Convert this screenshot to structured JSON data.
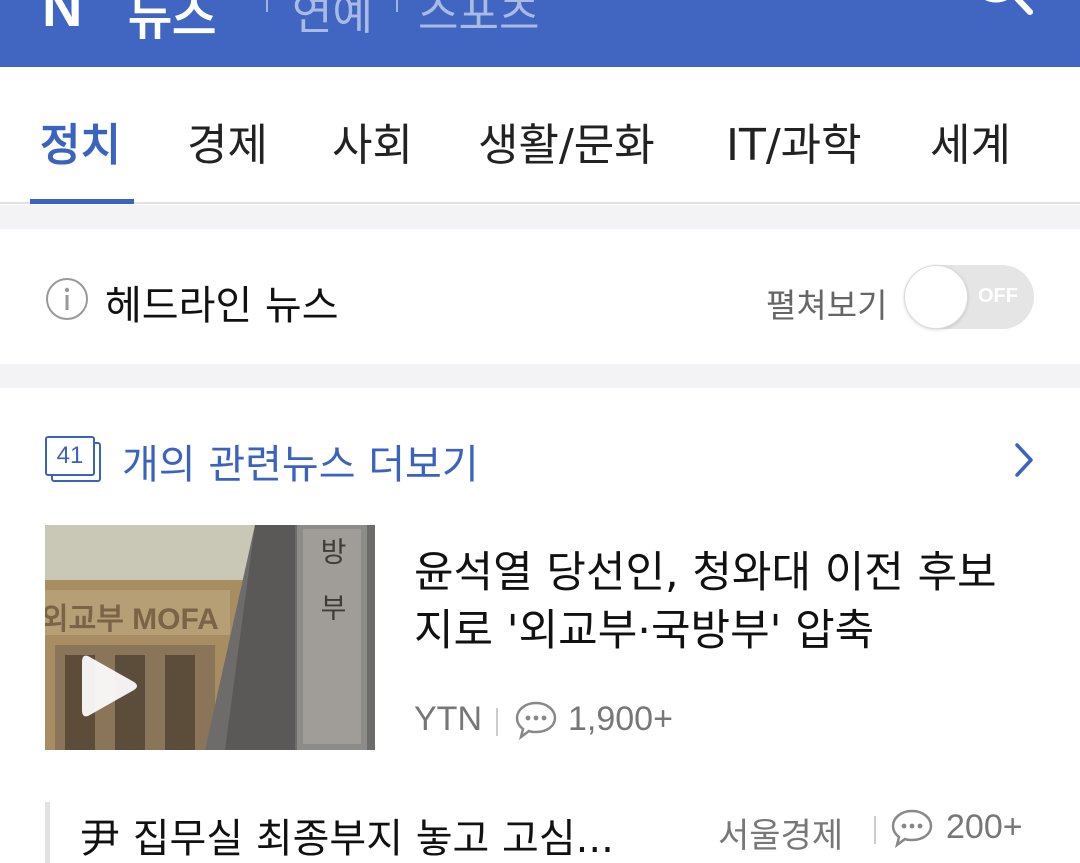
{
  "header": {
    "logo": "N",
    "brand": "뉴스",
    "menu": [
      "연예",
      "스포츠"
    ]
  },
  "tabs": [
    {
      "label": "정치",
      "active": true
    },
    {
      "label": "경제",
      "active": false
    },
    {
      "label": "사회",
      "active": false
    },
    {
      "label": "생활/문화",
      "active": false
    },
    {
      "label": "IT/과학",
      "active": false
    },
    {
      "label": "세계",
      "active": false
    }
  ],
  "headline": {
    "title": "헤드라인 뉴스",
    "expand_label": "펼쳐보기",
    "toggle_state": "OFF"
  },
  "related": {
    "count": "41",
    "label": "개의 관련뉴스 더보기"
  },
  "articles": [
    {
      "title": "윤석열 당선인, 청와대 이전 후보지로 '외교부·국방부' 압축",
      "source": "YTN",
      "comments": "1,900+",
      "thumbnail_text": {
        "left": "외교부 MOFA",
        "right": "국방부"
      }
    },
    {
      "title": "尹 집무실 최종부지 놓고 고심...",
      "source": "서울경제",
      "comments": "200+"
    }
  ],
  "colors": {
    "header_blue": "#4066c2",
    "accent": "#3a63c0"
  }
}
